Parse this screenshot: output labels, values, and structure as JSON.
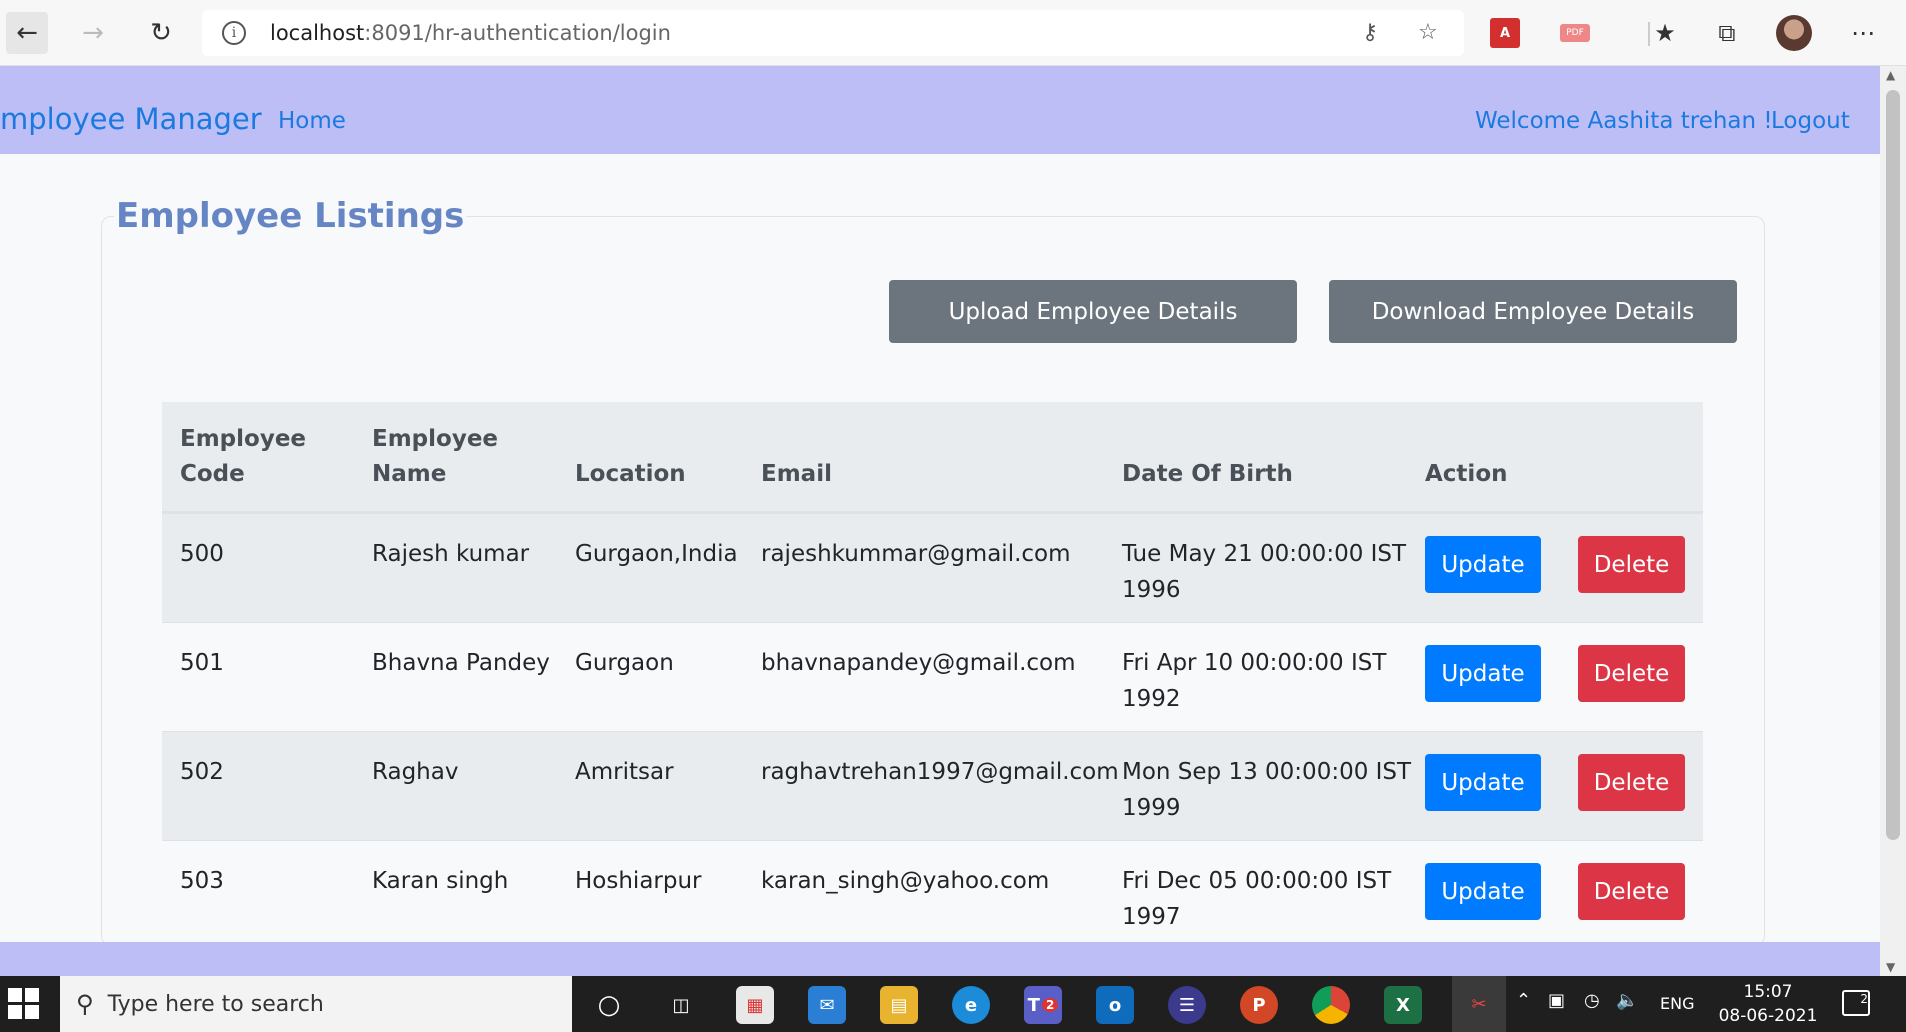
{
  "browser": {
    "url_host": "localhost",
    "url_rest": ":8091/hr-authentication/login"
  },
  "navbar": {
    "brand": "mployee Manager",
    "home": "Home",
    "welcome": "Welcome Aashita trehan !",
    "logout": "Logout"
  },
  "main": {
    "legend": "Employee Listings",
    "upload_button": "Upload Employee Details",
    "download_button": "Download Employee Details"
  },
  "table": {
    "headers": {
      "code_line1": "Employee",
      "code_line2": "Code",
      "name_line1": "Employee",
      "name_line2": "Name",
      "location": "Location",
      "email": "Email",
      "dob": "Date Of Birth",
      "action": "Action"
    },
    "rows": [
      {
        "code": "500",
        "name": "Rajesh kumar",
        "location": "Gurgaon,India",
        "email": "rajeshkummar@gmail.com",
        "dob": "Tue May 21 00:00:00 IST 1996",
        "update": "Update",
        "delete": "Delete"
      },
      {
        "code": "501",
        "name": "Bhavna Pandey",
        "location": "Gurgaon",
        "email": "bhavnapandey@gmail.com",
        "dob": "Fri Apr 10 00:00:00 IST 1992",
        "update": "Update",
        "delete": "Delete"
      },
      {
        "code": "502",
        "name": "Raghav",
        "location": "Amritsar",
        "email": "raghavtrehan1997@gmail.com",
        "dob": "Mon Sep 13 00:00:00 IST 1999",
        "update": "Update",
        "delete": "Delete"
      },
      {
        "code": "503",
        "name": "Karan singh",
        "location": "Hoshiarpur",
        "email": "karan_singh@yahoo.com",
        "dob": "Fri Dec 05 00:00:00 IST 1997",
        "update": "Update",
        "delete": "Delete"
      }
    ]
  },
  "taskbar": {
    "search_placeholder": "Type here to search",
    "language": "ENG",
    "time": "15:07",
    "date": "08-06-2021",
    "teams_badge": "2",
    "notification_count": "2"
  },
  "colors": {
    "navbar_bg": "#bebef7",
    "link": "#1a7ae0",
    "legend": "#6685c4",
    "grey_button": "#6c757d",
    "update_button": "#007bff",
    "delete_button": "#dc3545"
  }
}
